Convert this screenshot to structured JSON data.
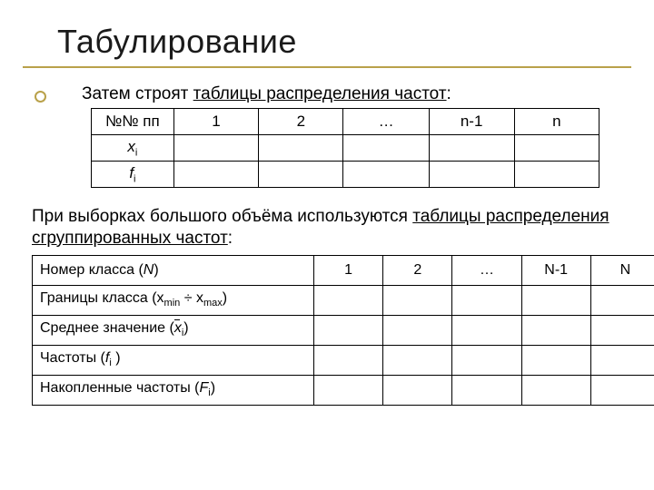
{
  "title": "Табулирование",
  "intro_plain": "Затем строят ",
  "intro_uline": "таблицы распределения частот",
  "intro_tail": ":",
  "table1": {
    "r0c0": "№№ пп",
    "r0": [
      "1",
      "2",
      "…",
      "n-1",
      "n"
    ],
    "r1c0_x": "x",
    "r1c0_sub": "i",
    "r2c0_f": "f",
    "r2c0_sub": "i"
  },
  "body_plain": "При выборках большого объёма используются ",
  "body_uline": "таблицы распределения сгруппированных частот",
  "body_tail": ":",
  "table2": {
    "row0_label_a": "Номер класса (",
    "row0_label_N": "N",
    "row0_label_b": ")",
    "row0": [
      "1",
      "2",
      "…",
      "N-1",
      "N"
    ],
    "row1_a": "Границы класса (x",
    "row1_min": "min",
    "row1_div": " ÷ x",
    "row1_max": "max",
    "row1_b": ")",
    "row2_a": "Среднее значение (",
    "row2_x": "x",
    "row2_sub": "i",
    "row2_b": ")",
    "row3_a": "Частоты  (",
    "row3_f": "f",
    "row3_sub": "i",
    "row3_b": " )",
    "row4_a": "Накопленные частоты (",
    "row4_F": "F",
    "row4_sub": "i",
    "row4_b": ")"
  }
}
